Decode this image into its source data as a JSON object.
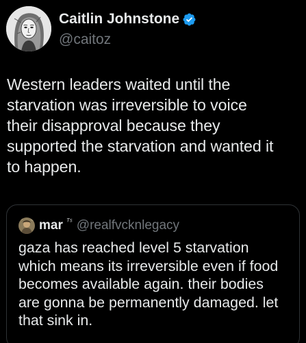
{
  "author": {
    "display_name": "Caitlin Johnstone",
    "handle": "@caitoz",
    "avatar_icon": "illustrated-portrait-avatar",
    "verified_icon": "verified-badge-icon",
    "verified_color": "#1d9bf0"
  },
  "tweet": {
    "lines": [
      "Western leaders waited until the",
      "starvation was irreversible to voice",
      "their disapproval because they",
      "supported the starvation and wanted it",
      "to happen."
    ]
  },
  "quoted_tweet": {
    "display_name": "mar",
    "name_suffix": "ᵀˢ",
    "handle": "@realfvcknlegacy",
    "avatar_icon": "small-photo-avatar",
    "lines": [
      "gaza has reached level 5 starvation",
      "which means its irreversible even if food",
      "becomes available again. their bodies",
      "are gonna be permanently damaged. let",
      "that sink in."
    ]
  },
  "colors": {
    "background": "#000000",
    "primary_text": "#e7e9ea",
    "secondary_text": "#71767b",
    "border": "#2f3336"
  }
}
